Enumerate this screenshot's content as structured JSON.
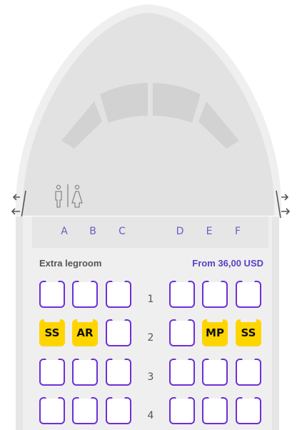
{
  "columns_left": [
    "A",
    "B",
    "C"
  ],
  "columns_right": [
    "D",
    "E",
    "F"
  ],
  "section": {
    "label": "Extra legroom",
    "price": "From 36,00 USD",
    "label_color": "#555555",
    "price_color": "#5b3fc4"
  },
  "rows": [
    {
      "number": "1",
      "seats": [
        "",
        "",
        "",
        "",
        "",
        ""
      ]
    },
    {
      "number": "2",
      "seats": [
        "SS",
        "AR",
        "",
        "",
        "MP",
        "SS"
      ]
    },
    {
      "number": "3",
      "seats": [
        "",
        "",
        "",
        "",
        "",
        ""
      ]
    },
    {
      "number": "4",
      "seats": [
        "",
        "",
        "",
        "",
        "",
        ""
      ]
    }
  ],
  "colors": {
    "seat_border": "#6d2fd6",
    "seat_occupied": "#ffd500",
    "fuselage": "#e4e4e4"
  },
  "icons": {
    "lavatory": "toilet-man-woman-icon",
    "exit_left": "exit-arrows-left-icon",
    "exit_right": "exit-arrows-right-icon"
  }
}
